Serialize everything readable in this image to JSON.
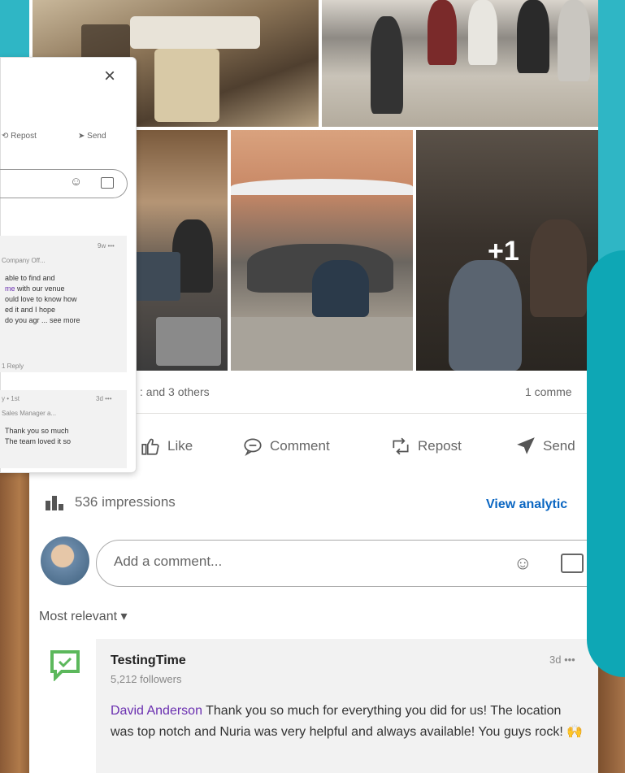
{
  "post": {
    "photo_overflow": "+1",
    "reactions_text": ": and 3 others",
    "comments_count": "1 comme",
    "actions": {
      "like": "Like",
      "comment": "Comment",
      "repost": "Repost",
      "send": "Send"
    },
    "impressions": "536 impressions",
    "view_analytics": "View analytic",
    "comment_placeholder": "Add a comment...",
    "sort_label": "Most relevant ▾"
  },
  "comment": {
    "author": "TestingTime",
    "followers": "5,212 followers",
    "time": "3d •••",
    "mention": "David Anderson",
    "text": " Thank you so much for everything you did for us! The location was top notch and Nuria was very helpful and always available! You guys rock! 🙌"
  },
  "overlay": {
    "close": "×",
    "repost": "Repost",
    "send": "Send",
    "c1_time": "9w •••",
    "c1_sub": "Company Off...",
    "c1_line1": "able to find and",
    "c1_line2_link": "me",
    "c1_line2": " with our venue",
    "c1_line3": "ould love to know how",
    "c1_line4": "ed it and I hope",
    "c1_line5": "do you agr ... see more",
    "c1_replies": "1 Reply",
    "c2_meta": "y • 1st",
    "c2_time": "3d •••",
    "c2_sub": "Sales Manager a...",
    "c2_line1": "Thank you so much",
    "c2_line2": "The team loved it so"
  },
  "colors": {
    "accent": "#0a66c2",
    "teal": "#2fb6c5",
    "mention": "#6a2fb0"
  }
}
